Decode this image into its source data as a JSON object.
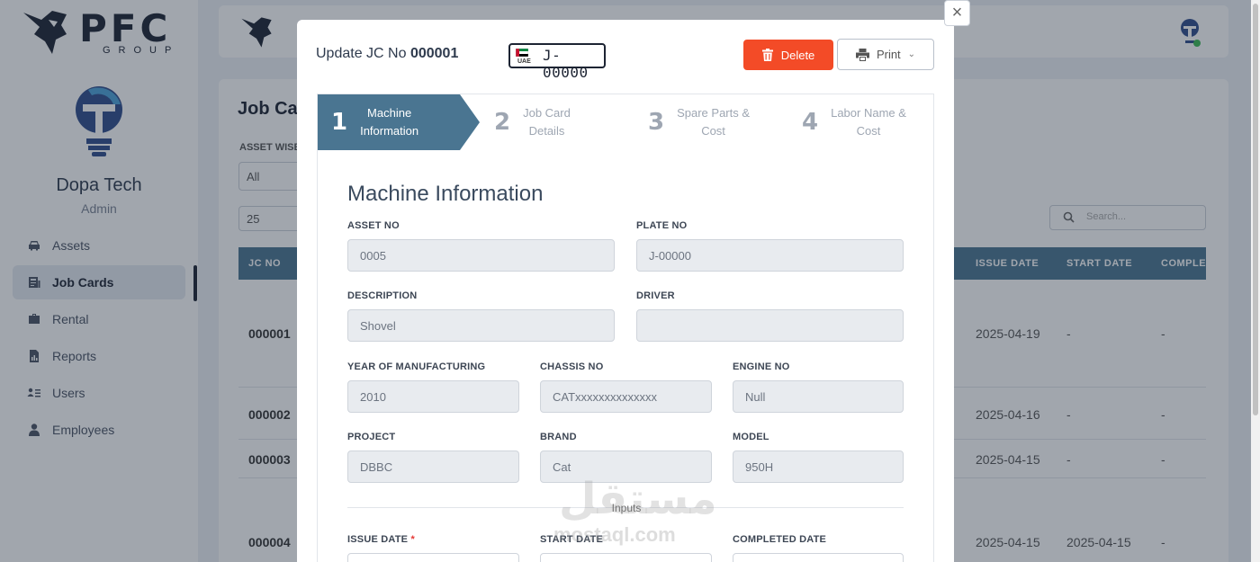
{
  "brand": {
    "name": "PFC",
    "sub": "GROUP"
  },
  "company": {
    "name": "Dopa Tech",
    "role": "Admin"
  },
  "nav": [
    {
      "label": "Assets",
      "icon": "car-icon"
    },
    {
      "label": "Job Cards",
      "icon": "job-card-icon",
      "active": true
    },
    {
      "label": "Rental",
      "icon": "briefcase-icon"
    },
    {
      "label": "Reports",
      "icon": "report-icon"
    },
    {
      "label": "Users",
      "icon": "users-icon"
    },
    {
      "label": "Employees",
      "icon": "employee-icon"
    }
  ],
  "page": {
    "title": "Job Car",
    "filter_label": "ASSET WISE",
    "filter_value": "All",
    "page_size": "25",
    "search_placeholder": "Search..."
  },
  "table": {
    "headers": {
      "jc": "JC NO",
      "issue": "ISSUE DATE",
      "start": "START DATE",
      "completed": "COMPLE"
    },
    "rows": [
      {
        "jc": "000001",
        "issue": "2025-04-19",
        "start": "-",
        "completed": "-"
      },
      {
        "jc": "000002",
        "issue": "2025-04-16",
        "start": "-",
        "completed": "-"
      },
      {
        "jc": "000003",
        "issue": "2025-04-15",
        "start": "-",
        "completed": "-"
      },
      {
        "jc": "000004",
        "issue": "2025-04-15",
        "start": "2025-04-15",
        "completed": "-"
      }
    ]
  },
  "modal": {
    "title_prefix": "Update JC No",
    "jc_no": "000001",
    "plate": {
      "country": "UAE",
      "number": "J-00000"
    },
    "delete_label": "Delete",
    "print_label": "Print",
    "close": "×",
    "steps": [
      {
        "num": "1",
        "line1": "Machine",
        "line2": "Information"
      },
      {
        "num": "2",
        "line1": "Job Card",
        "line2": "Details"
      },
      {
        "num": "3",
        "line1": "Spare Parts &",
        "line2": "Cost"
      },
      {
        "num": "4",
        "line1": "Labor Name &",
        "line2": "Cost"
      }
    ],
    "section_title": "Machine Information",
    "fields": {
      "asset_no": {
        "label": "ASSET NO",
        "value": "0005"
      },
      "plate_no": {
        "label": "PLATE NO",
        "value": "J-00000"
      },
      "description": {
        "label": "DESCRIPTION",
        "value": "Shovel"
      },
      "driver": {
        "label": "DRIVER",
        "value": ""
      },
      "year": {
        "label": "YEAR OF MANUFACTURING",
        "value": "2010"
      },
      "chassis": {
        "label": "CHASSIS NO",
        "value": "CATxxxxxxxxxxxxxx"
      },
      "engine": {
        "label": "ENGINE NO",
        "value": "Null"
      },
      "project": {
        "label": "PROJECT",
        "value": "DBBC"
      },
      "brand": {
        "label": "BRAND",
        "value": "Cat"
      },
      "model": {
        "label": "MODEL",
        "value": "950H"
      },
      "issue_date": {
        "label": "ISSUE DATE",
        "required": "*"
      },
      "start_date": {
        "label": "START DATE"
      },
      "completed_date": {
        "label": "COMPLETED DATE"
      }
    },
    "divider_label": "Inputs"
  },
  "watermark": {
    "arabic": "مستقل",
    "latin": "mostaql.com"
  },
  "colors": {
    "accent": "#4a7591",
    "delete": "#f34b27",
    "nav_dark": "#1d2433"
  }
}
